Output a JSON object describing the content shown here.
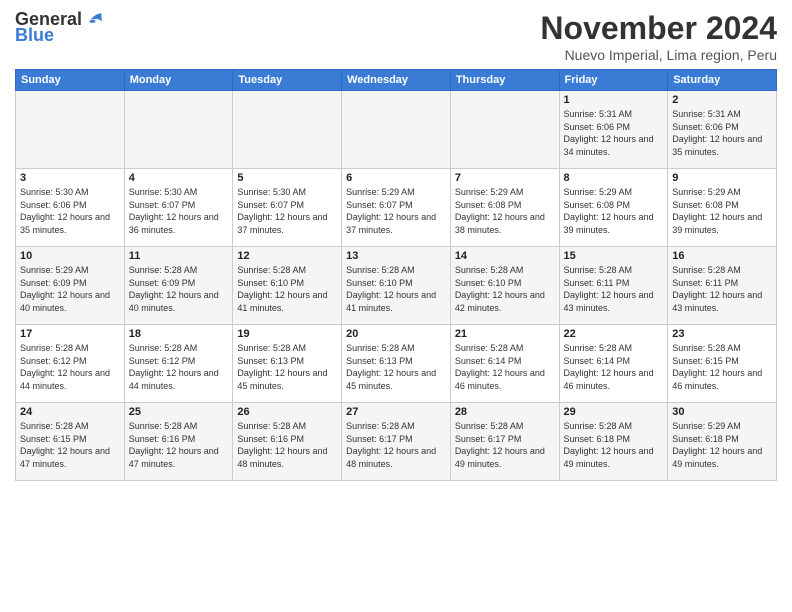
{
  "header": {
    "logo_line1": "General",
    "logo_line2": "Blue",
    "month": "November 2024",
    "location": "Nuevo Imperial, Lima region, Peru"
  },
  "days_of_week": [
    "Sunday",
    "Monday",
    "Tuesday",
    "Wednesday",
    "Thursday",
    "Friday",
    "Saturday"
  ],
  "weeks": [
    [
      {
        "day": "",
        "info": ""
      },
      {
        "day": "",
        "info": ""
      },
      {
        "day": "",
        "info": ""
      },
      {
        "day": "",
        "info": ""
      },
      {
        "day": "",
        "info": ""
      },
      {
        "day": "1",
        "info": "Sunrise: 5:31 AM\nSunset: 6:06 PM\nDaylight: 12 hours and 34 minutes."
      },
      {
        "day": "2",
        "info": "Sunrise: 5:31 AM\nSunset: 6:06 PM\nDaylight: 12 hours and 35 minutes."
      }
    ],
    [
      {
        "day": "3",
        "info": "Sunrise: 5:30 AM\nSunset: 6:06 PM\nDaylight: 12 hours and 35 minutes."
      },
      {
        "day": "4",
        "info": "Sunrise: 5:30 AM\nSunset: 6:07 PM\nDaylight: 12 hours and 36 minutes."
      },
      {
        "day": "5",
        "info": "Sunrise: 5:30 AM\nSunset: 6:07 PM\nDaylight: 12 hours and 37 minutes."
      },
      {
        "day": "6",
        "info": "Sunrise: 5:29 AM\nSunset: 6:07 PM\nDaylight: 12 hours and 37 minutes."
      },
      {
        "day": "7",
        "info": "Sunrise: 5:29 AM\nSunset: 6:08 PM\nDaylight: 12 hours and 38 minutes."
      },
      {
        "day": "8",
        "info": "Sunrise: 5:29 AM\nSunset: 6:08 PM\nDaylight: 12 hours and 39 minutes."
      },
      {
        "day": "9",
        "info": "Sunrise: 5:29 AM\nSunset: 6:08 PM\nDaylight: 12 hours and 39 minutes."
      }
    ],
    [
      {
        "day": "10",
        "info": "Sunrise: 5:29 AM\nSunset: 6:09 PM\nDaylight: 12 hours and 40 minutes."
      },
      {
        "day": "11",
        "info": "Sunrise: 5:28 AM\nSunset: 6:09 PM\nDaylight: 12 hours and 40 minutes."
      },
      {
        "day": "12",
        "info": "Sunrise: 5:28 AM\nSunset: 6:10 PM\nDaylight: 12 hours and 41 minutes."
      },
      {
        "day": "13",
        "info": "Sunrise: 5:28 AM\nSunset: 6:10 PM\nDaylight: 12 hours and 41 minutes."
      },
      {
        "day": "14",
        "info": "Sunrise: 5:28 AM\nSunset: 6:10 PM\nDaylight: 12 hours and 42 minutes."
      },
      {
        "day": "15",
        "info": "Sunrise: 5:28 AM\nSunset: 6:11 PM\nDaylight: 12 hours and 43 minutes."
      },
      {
        "day": "16",
        "info": "Sunrise: 5:28 AM\nSunset: 6:11 PM\nDaylight: 12 hours and 43 minutes."
      }
    ],
    [
      {
        "day": "17",
        "info": "Sunrise: 5:28 AM\nSunset: 6:12 PM\nDaylight: 12 hours and 44 minutes."
      },
      {
        "day": "18",
        "info": "Sunrise: 5:28 AM\nSunset: 6:12 PM\nDaylight: 12 hours and 44 minutes."
      },
      {
        "day": "19",
        "info": "Sunrise: 5:28 AM\nSunset: 6:13 PM\nDaylight: 12 hours and 45 minutes."
      },
      {
        "day": "20",
        "info": "Sunrise: 5:28 AM\nSunset: 6:13 PM\nDaylight: 12 hours and 45 minutes."
      },
      {
        "day": "21",
        "info": "Sunrise: 5:28 AM\nSunset: 6:14 PM\nDaylight: 12 hours and 46 minutes."
      },
      {
        "day": "22",
        "info": "Sunrise: 5:28 AM\nSunset: 6:14 PM\nDaylight: 12 hours and 46 minutes."
      },
      {
        "day": "23",
        "info": "Sunrise: 5:28 AM\nSunset: 6:15 PM\nDaylight: 12 hours and 46 minutes."
      }
    ],
    [
      {
        "day": "24",
        "info": "Sunrise: 5:28 AM\nSunset: 6:15 PM\nDaylight: 12 hours and 47 minutes."
      },
      {
        "day": "25",
        "info": "Sunrise: 5:28 AM\nSunset: 6:16 PM\nDaylight: 12 hours and 47 minutes."
      },
      {
        "day": "26",
        "info": "Sunrise: 5:28 AM\nSunset: 6:16 PM\nDaylight: 12 hours and 48 minutes."
      },
      {
        "day": "27",
        "info": "Sunrise: 5:28 AM\nSunset: 6:17 PM\nDaylight: 12 hours and 48 minutes."
      },
      {
        "day": "28",
        "info": "Sunrise: 5:28 AM\nSunset: 6:17 PM\nDaylight: 12 hours and 49 minutes."
      },
      {
        "day": "29",
        "info": "Sunrise: 5:28 AM\nSunset: 6:18 PM\nDaylight: 12 hours and 49 minutes."
      },
      {
        "day": "30",
        "info": "Sunrise: 5:29 AM\nSunset: 6:18 PM\nDaylight: 12 hours and 49 minutes."
      }
    ]
  ]
}
